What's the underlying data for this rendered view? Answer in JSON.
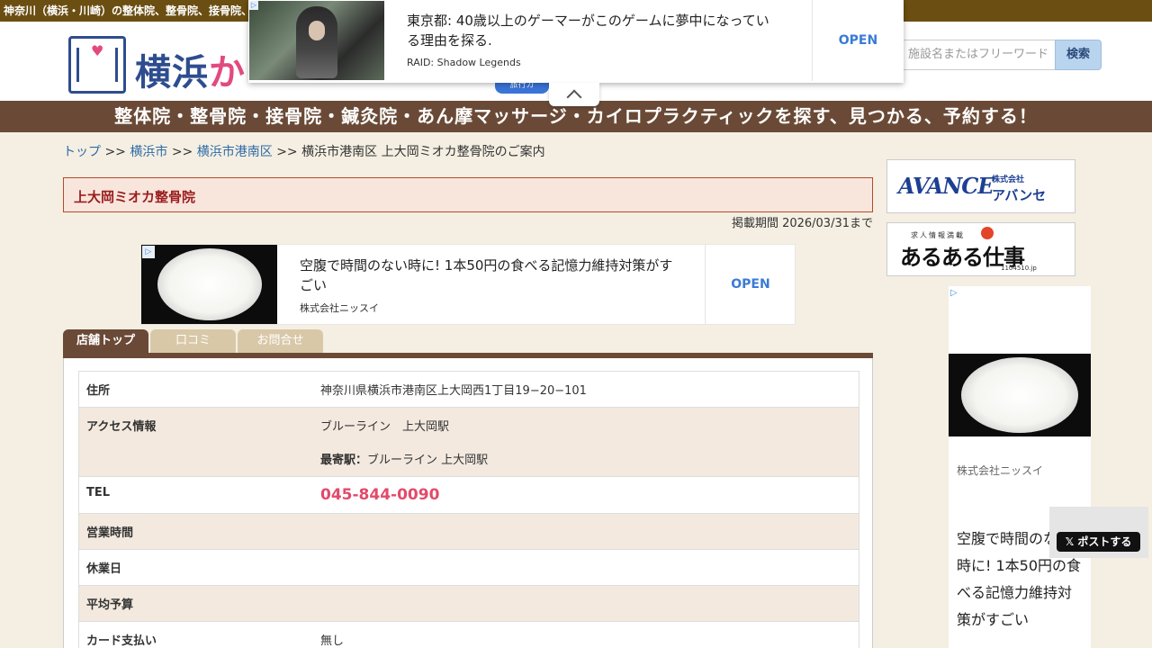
{
  "topbar": {
    "text": "神奈川（横浜・川崎）の整体院、整骨院、接骨院、"
  },
  "header": {
    "logo_text_a": "横浜",
    "logo_text_b": "か",
    "search_placeholder": "施設名またはフリーワード",
    "search_button": "検索"
  },
  "banner": {
    "text": "整体院・整骨院・接骨院・鍼灸院・あん摩マッサージ・カイロプラクティックを探す、見つかる、予約する！"
  },
  "popup_ad": {
    "headline": "東京都: 40歳以上のゲーマーがこのゲームに夢中になっている理由を探る.",
    "sponsor": "RAID: Shadow Legends",
    "open": "OPEN",
    "pill": "旅行カ"
  },
  "breadcrumb": {
    "top": "トップ",
    "sep": ">>",
    "city": "横浜市",
    "ward": "横浜市港南区",
    "current": "横浜市港南区 上大岡ミオカ整骨院のご案内"
  },
  "shop": {
    "title": "上大岡ミオカ整骨院",
    "period": "掲載期間 2026/03/31まで"
  },
  "mid_ad": {
    "headline": "空腹で時間のない時に! 1本50円の食べる記憶力維持対策がすごい",
    "sponsor": "株式会社ニッスイ",
    "open": "OPEN"
  },
  "tabs": [
    {
      "label": "店舗トップ",
      "active": true
    },
    {
      "label": "口コミ",
      "active": false
    },
    {
      "label": "お問合せ",
      "active": false
    }
  ],
  "info": {
    "address_label": "住所",
    "address_value": "神奈川県横浜市港南区上大岡西1丁目19−20−101",
    "access_label": "アクセス情報",
    "access_value": "ブルーライン　上大岡駅",
    "nearest_label": "最寄駅：",
    "nearest_value": "ブルーライン 上大岡駅",
    "tel_label": "TEL",
    "tel_value": "045-844-0090",
    "hours_label": "営業時間",
    "hours_value": "",
    "holiday_label": "休業日",
    "holiday_value": "",
    "budget_label": "平均予算",
    "budget_value": "",
    "card_label": "カード支払い",
    "card_value": "無し"
  },
  "side": {
    "avance_logo": "AVANCE",
    "avance_corp": "株式会社",
    "avance_jp": "アバンセ",
    "aruaru_top": "求人情報満載",
    "aruaru": "あるある仕事",
    "aruaru_url": "1104510.jp",
    "ad_sponsor": "株式会社ニッスイ",
    "ad_headline": "空腹で時間のない時に! 1本50円の食べる記憶力維持対策がすごい"
  },
  "share": {
    "x_post": "ポストする"
  },
  "colors": {
    "topbar": "#6b4e12",
    "banner": "#6a4a36",
    "brand_blue": "#2e4d8f",
    "brand_pink": "#e24a7f",
    "title_red": "#9a1c1c",
    "tel_pink": "#e24a6a",
    "link_blue": "#2e6aa8"
  }
}
